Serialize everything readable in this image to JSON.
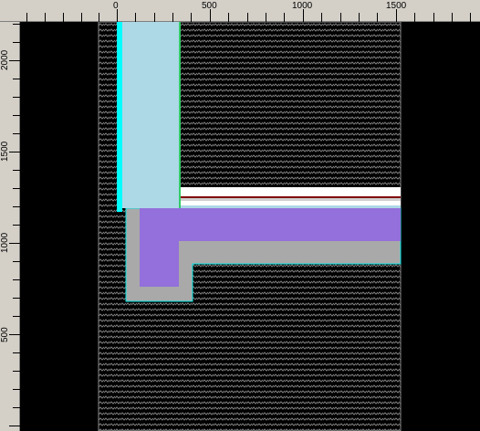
{
  "ruler": {
    "horizontal_labels": [
      "0",
      "500",
      "1000",
      "1500"
    ],
    "vertical_labels": [
      "2000",
      "1500",
      "1000",
      "500"
    ]
  },
  "colors": {
    "background": "#000000",
    "ruler_bg": "#d4d0c8",
    "hatch": "#7f7f7f",
    "insulation_blue": "#add8e6",
    "purple": "#9370db",
    "gray": "#a9a9a9",
    "cyan": "#00ffff",
    "green": "#00ff7f",
    "white": "#ffffff",
    "maroon": "#800000"
  }
}
